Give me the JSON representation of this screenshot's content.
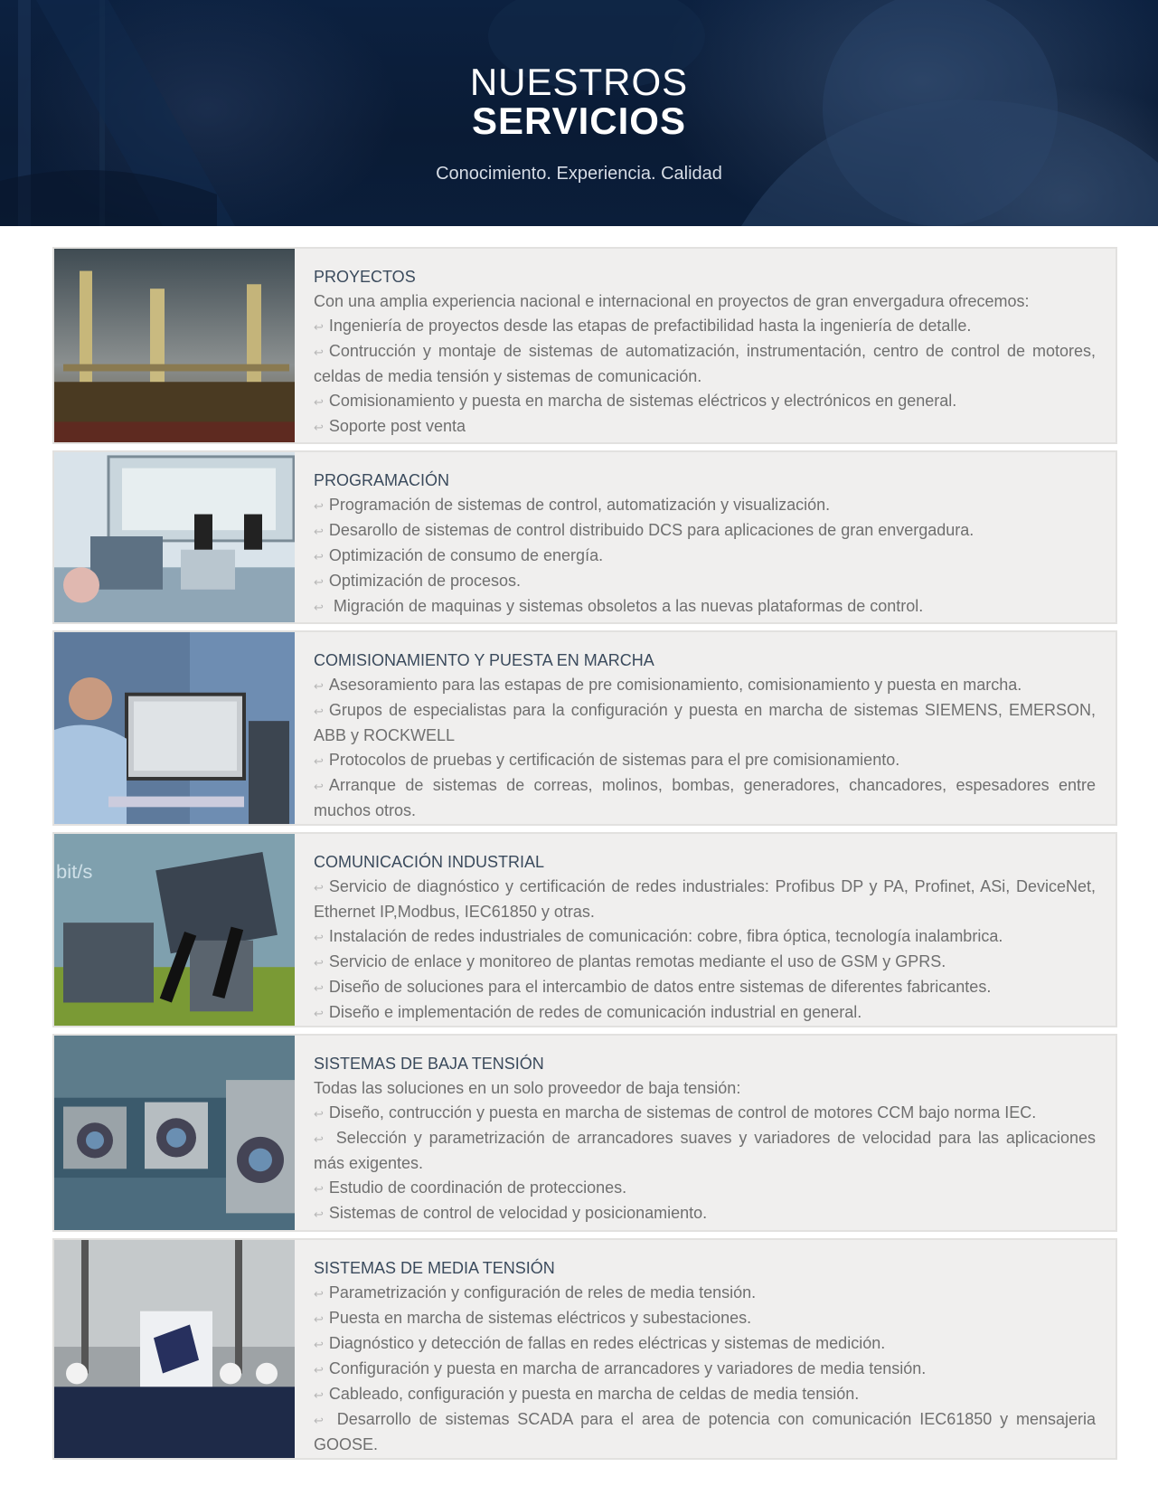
{
  "hero": {
    "title_line1": "NUESTROS",
    "title_line2": "SERVICIOS",
    "subtitle": "Conocimiento. Experiencia. Calidad"
  },
  "bullet_icon": "return-arrow-icon",
  "colors": {
    "hero_bg": "#0c2140",
    "card_bg": "#f0efee",
    "title": "#3a4a5c",
    "text": "#6f6f6f"
  },
  "services": [
    {
      "title": "PROYECTOS",
      "intro": "Con una amplia experiencia nacional e internacional en proyectos de gran envergadura ofrecemos:",
      "items": [
        "Ingeniería de proyectos desde las etapas de prefactibilidad hasta la ingeniería de detalle.",
        "Contrucción y montaje de sistemas de automatización, instrumentación, centro de control de motores, celdas de media tensión y sistemas de comunicación.",
        "Comisionamiento y puesta en marcha de sistemas eléctricos y electrónicos en general.",
        "Soporte post venta"
      ]
    },
    {
      "title": "PROGRAMACIÓN",
      "items": [
        "Programación de sistemas de control, automatización y visualización.",
        "Desarollo de sistemas de control distribuido DCS para aplicaciones de gran envergadura.",
        "Optimización de consumo de energía.",
        "Optimización de procesos.",
        " Migración de maquinas y sistemas obsoletos a las nuevas plataformas de control."
      ]
    },
    {
      "title": "COMISIONAMIENTO Y PUESTA EN MARCHA",
      "items": [
        "Asesoramiento para las estapas de pre comisionamiento, comisionamiento y puesta en marcha.",
        "Grupos de especialistas para la configuración y puesta en marcha de sistemas SIEMENS, EMERSON, ABB y ROCKWELL",
        "Protocolos de pruebas y certificación de sistemas para el pre comisionamiento.",
        "Arranque de sistemas de correas, molinos, bombas, generadores, chancadores, espesadores entre muchos otros."
      ]
    },
    {
      "title": "COMUNICACIÓN INDUSTRIAL",
      "items": [
        "Servicio de diagnóstico y certificación de redes industriales: Profibus DP y PA, Profinet, ASi, DeviceNet, Ethernet IP,Modbus, IEC61850 y otras.",
        "Instalación de redes industriales de comunicación: cobre, fibra óptica, tecnología inalambrica.",
        "Servicio de enlace y monitoreo de plantas remotas mediante el uso de GSM y GPRS.",
        "Diseño de soluciones para el intercambio de datos entre sistemas de diferentes fabricantes.",
        "Diseño e implementación de redes de comunicación industrial en general."
      ]
    },
    {
      "title": "SISTEMAS DE BAJA TENSIÓN",
      "intro": "Todas las soluciones en un solo proveedor de baja tensión:",
      "items": [
        "Diseño, contrucción y puesta en marcha de sistemas de control de motores CCM bajo norma IEC.",
        " Selección y parametrización de arrancadores suaves y variadores de velocidad para las aplicaciones más exigentes.",
        "Estudio de coordinación de protecciones.",
        "Sistemas de control de velocidad y posicionamiento."
      ]
    },
    {
      "title": "SISTEMAS DE MEDIA TENSIÓN",
      "items": [
        "Parametrización y configuración de reles de media tensión.",
        "Puesta en marcha de sistemas eléctricos y subestaciones.",
        "Diagnóstico y detección de fallas en redes eléctricas y sistemas de medición.",
        "Configuración y puesta en marcha de arrancadores y variadores de media tensión.",
        "Cableado, configuración y puesta en marcha de celdas de media tensión.",
        " Desarrollo de sistemas SCADA para el area de potencia con comunicación IEC61850 y mensajeria GOOSE."
      ]
    }
  ]
}
